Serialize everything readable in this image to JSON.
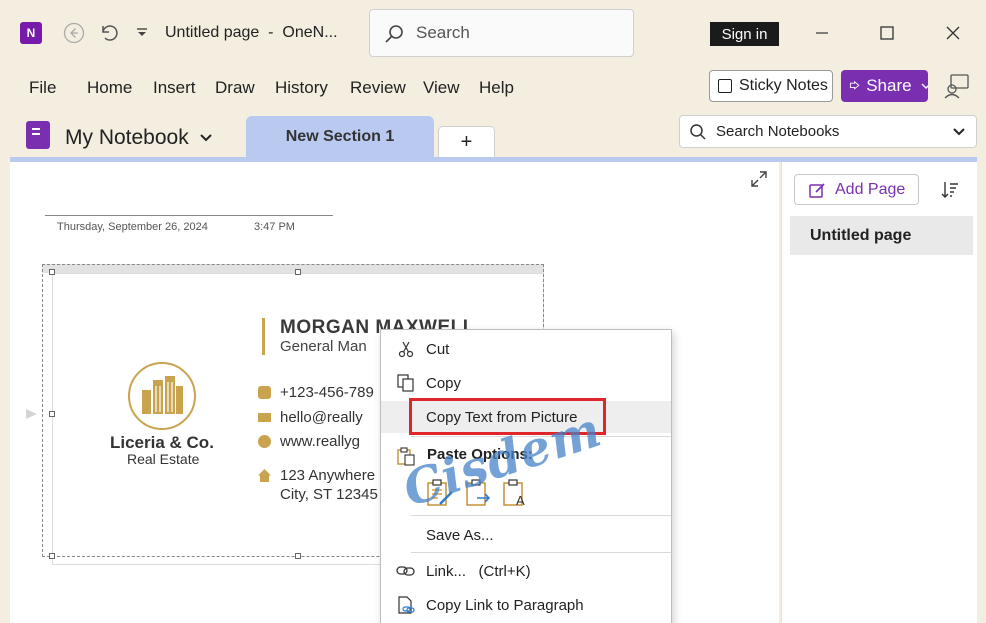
{
  "titlebar": {
    "app_letter": "N",
    "window_title": "Untitled page  -  OneN...",
    "search_placeholder": "Search",
    "sign_in": "Sign in"
  },
  "menu": {
    "items": [
      "File",
      "Home",
      "Insert",
      "Draw",
      "History",
      "Review",
      "View",
      "Help"
    ],
    "sticky_notes": "Sticky Notes",
    "share": "Share"
  },
  "notebook": {
    "name": "My Notebook",
    "active_section": "New Section 1",
    "add_section": "+",
    "search_placeholder": "Search Notebooks"
  },
  "page": {
    "date": "Thursday, September 26, 2024",
    "time": "3:47 PM"
  },
  "card": {
    "company": "Liceria & Co.",
    "company_sub": "Real Estate",
    "person": "MORGAN MAXWELL",
    "role": "General Man",
    "phone": "+123-456-789",
    "email": "hello@really",
    "website": "www.reallyg",
    "address1": "123 Anywhere",
    "address2": "City, ST 12345"
  },
  "pages_pane": {
    "add_page": "Add Page",
    "pages": [
      "Untitled page"
    ]
  },
  "context_menu": {
    "cut": "Cut",
    "copy": "Copy",
    "copy_text_from_picture": "Copy Text from Picture",
    "paste_options": "Paste Options:",
    "save_as": "Save As...",
    "link": "Link...   (Ctrl+K)",
    "copy_link_to_paragraph": "Copy Link to Paragraph"
  },
  "watermark": "Cisdem",
  "colors": {
    "accent_purple": "#7a2fb1",
    "section_tab": "#b9c9f0",
    "highlight_red": "#e0262b",
    "gold": "#c9a34d"
  }
}
